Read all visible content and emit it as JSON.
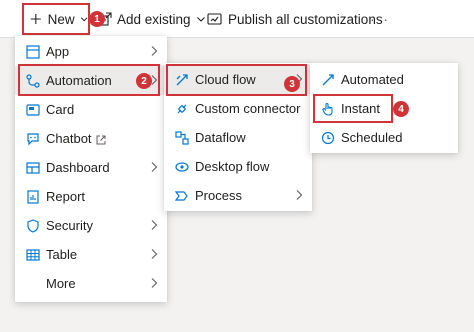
{
  "toolbar": {
    "new_label": "New",
    "add_existing_label": "Add existing",
    "publish_label": "Publish all customizations",
    "more_label": "···"
  },
  "badges": [
    "1",
    "2",
    "3",
    "4"
  ],
  "menu_primary": {
    "items": [
      {
        "label": "App",
        "icon": "app-grid-icon",
        "has_submenu": true
      },
      {
        "label": "Automation",
        "icon": "flow-icon",
        "has_submenu": true,
        "selected": true
      },
      {
        "label": "Card",
        "icon": "card-icon",
        "has_submenu": false
      },
      {
        "label": "Chatbot",
        "icon": "chatbot-icon",
        "has_submenu": false,
        "external": true
      },
      {
        "label": "Dashboard",
        "icon": "dashboard-icon",
        "has_submenu": true
      },
      {
        "label": "Report",
        "icon": "report-icon",
        "has_submenu": false
      },
      {
        "label": "Security",
        "icon": "shield-icon",
        "has_submenu": true
      },
      {
        "label": "Table",
        "icon": "table-icon",
        "has_submenu": true
      },
      {
        "label": "More",
        "icon": "",
        "has_submenu": true
      }
    ]
  },
  "menu_automation": {
    "items": [
      {
        "label": "Cloud flow",
        "icon": "cloud-flow-icon",
        "has_submenu": true,
        "selected": true
      },
      {
        "label": "Custom connector",
        "icon": "connector-icon",
        "has_submenu": false
      },
      {
        "label": "Dataflow",
        "icon": "dataflow-icon",
        "has_submenu": false
      },
      {
        "label": "Desktop flow",
        "icon": "desktop-flow-icon",
        "has_submenu": false
      },
      {
        "label": "Process",
        "icon": "process-icon",
        "has_submenu": true
      }
    ]
  },
  "menu_cloud_flow": {
    "items": [
      {
        "label": "Automated",
        "icon": "automated-icon"
      },
      {
        "label": "Instant",
        "icon": "touch-icon"
      },
      {
        "label": "Scheduled",
        "icon": "clock-icon"
      }
    ]
  },
  "colors": {
    "accent_blue": "#0078d4",
    "highlight_red": "#d13438",
    "selected_bg": "#edebe9"
  }
}
